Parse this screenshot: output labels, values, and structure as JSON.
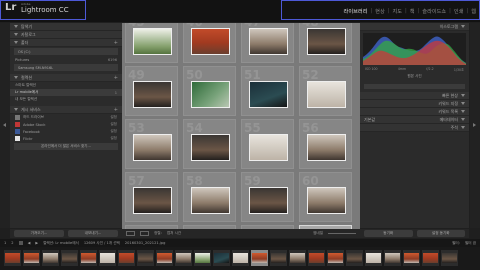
{
  "topbar": {
    "logo": "Lr",
    "brand_small": "Adobe",
    "brand": "Lightroom CC",
    "modules": [
      "라이브러리",
      "현상",
      "지도",
      "책",
      "슬라이드쇼",
      "인쇄",
      "웹"
    ],
    "active_module": "라이브러리"
  },
  "left_panel": {
    "navigator": "탐색기",
    "catalog": "카탈로그",
    "folders": "폴더",
    "folder_rows": [
      {
        "label": "OS (C:)",
        "value": ""
      },
      {
        "label": "Pictures",
        "value": "6196"
      },
      {
        "label": "Samsung SM-N916L",
        "value": ""
      }
    ],
    "collections": "컬렉션",
    "collection_rows": [
      {
        "label": "스마트 컬렉션",
        "value": ""
      },
      {
        "label": "Lr mobile에서",
        "value": "1"
      },
      {
        "label": "내 모든 컬렉션",
        "value": ""
      }
    ],
    "publish": "게시 서비스",
    "publish_rows": [
      {
        "label": "하드 드라이브",
        "value": "설정"
      },
      {
        "label": "Adobe Stock",
        "value": "설정"
      },
      {
        "label": "Facebook",
        "value": "설정"
      },
      {
        "label": "Flickr",
        "value": "설정"
      }
    ],
    "more_services": "온라인에서 더 많은 서비스 찾기...",
    "import_btn": "가져오기...",
    "export_btn": "내보내기..."
  },
  "grid": {
    "start_number": 45,
    "thumbs": [
      "t-green2",
      "t-red",
      "t-room",
      "t-dark",
      "t-dark",
      "t-green",
      "t-teal",
      "t-white",
      "t-room",
      "t-dark",
      "t-white",
      "t-room",
      "t-dark",
      "t-room",
      "t-dark",
      "t-room",
      "t-orange",
      "t-orange",
      "t-orange",
      "t-white"
    ],
    "selected_index": 19
  },
  "toolbar": {
    "sort_label": "정렬:",
    "sort_value": "캡처 시간",
    "thumbnails_label": "썸네일"
  },
  "filmstrip_bar": {
    "page1": "1",
    "page2": "2",
    "source": "컬렉션: Lr mobile에서",
    "count": "12609 사진 / 1개 선택",
    "filename": "20160301_202121.jpg",
    "filter_label": "필터:",
    "filter_value": "필터 끔"
  },
  "right_panel": {
    "histogram": "히스토그램",
    "histo_info": [
      "ISO 100",
      "4mm",
      "f/2.2",
      "1/30초"
    ],
    "orig_photo": "원본 사진",
    "quick_develop": "빠른 현상",
    "keywording": "키워드 지정",
    "keyword_list": "키워드 목록",
    "metadata": "메타데이터",
    "default_label": "기본값",
    "comments": "주석",
    "sync_btn": "동기화",
    "sync_settings_btn": "설정 동기화"
  },
  "colors": {
    "accent_selection": "#4d59d6",
    "panel_bg": "#2b2b2b",
    "grid_bg": "#7a7a7a"
  }
}
